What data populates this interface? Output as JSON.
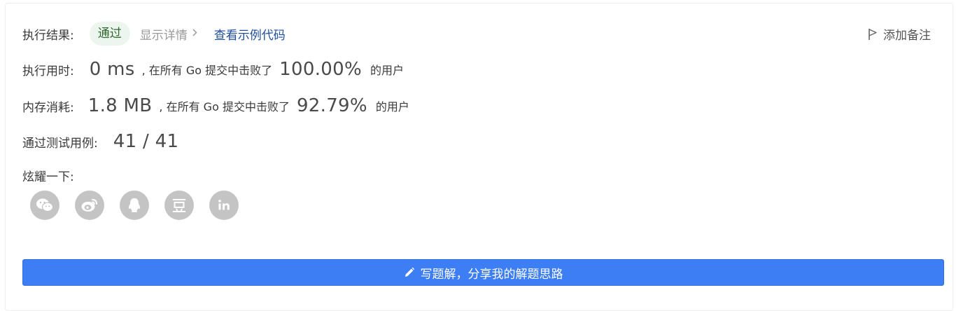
{
  "result": {
    "label": "执行结果:",
    "status": "通过",
    "details_link": "显示详情",
    "example_link": "查看示例代码",
    "note_button": "添加备注"
  },
  "runtime": {
    "label": "执行用时:",
    "value": "0 ms",
    "text_before": ", 在所有 Go 提交中击败了",
    "percent": "100.00%",
    "text_after": "的用户"
  },
  "memory": {
    "label": "内存消耗:",
    "value": "1.8 MB",
    "text_before": ", 在所有 Go 提交中击败了",
    "percent": "92.79%",
    "text_after": "的用户"
  },
  "tests": {
    "label": "通过测试用例:",
    "value": "41 / 41"
  },
  "share": {
    "label": "炫耀一下:",
    "icons": [
      "wechat-icon",
      "weibo-icon",
      "qq-icon",
      "douban-icon",
      "linkedin-icon"
    ]
  },
  "write_solution": {
    "label": "写题解，分享我的解题思路"
  },
  "colors": {
    "accent": "#3d7ef5",
    "success_bg": "#edf6ee",
    "success_text": "#2f6a30",
    "link": "#1f4e9c",
    "share_icon_bg": "#c4c4c4"
  }
}
